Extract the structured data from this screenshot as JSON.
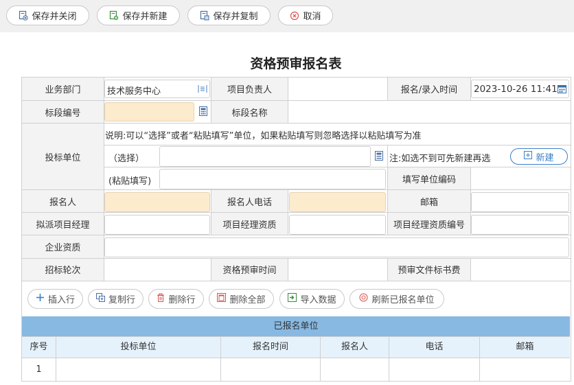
{
  "toolbar": {
    "save_close": "保存并关闭",
    "save_new": "保存并新建",
    "save_copy": "保存并复制",
    "cancel": "取消"
  },
  "form": {
    "title": "资格预审报名表",
    "dept_label": "业务部门",
    "dept_value": "技术服务中心",
    "pm_owner_label": "项目负责人",
    "reg_time_label": "报名/录入时间",
    "reg_time_value": "2023-10-26 11:41",
    "section_no_label": "标段编号",
    "section_name_label": "标段名称",
    "bidder_label": "投标单位",
    "note": "说明:可以“选择”或者“粘贴填写”单位，如果粘贴填写则忽略选择以粘贴填写为准",
    "select_label": "（选择）",
    "select_hint": "注:如选不到可先新建再选",
    "new_button": "新建",
    "paste_label": "(粘贴填写)",
    "unit_code_label": "填写单位编码",
    "applicant_label": "报名人",
    "applicant_phone_label": "报名人电话",
    "email_label": "邮箱",
    "pm_label": "拟派项目经理",
    "pm_qual_label": "项目经理资质",
    "pm_qual_no_label": "项目经理资质编号",
    "company_qual_label": "企业资质",
    "round_label": "招标轮次",
    "prequal_time_label": "资格预审时间",
    "doc_fee_label": "预审文件标书费"
  },
  "row_actions": {
    "insert": "插入行",
    "copy": "复制行",
    "delete": "删除行",
    "delete_all": "删除全部",
    "import": "导入数据",
    "refresh": "刷新已报名单位"
  },
  "registered": {
    "title": "已报名单位",
    "columns": [
      "序号",
      "投标单位",
      "报名时间",
      "报名人",
      "电话",
      "邮箱"
    ],
    "rows": [
      [
        "1",
        "",
        "",
        "",
        "",
        ""
      ]
    ]
  },
  "colors": {
    "required_bg": "#fdebcd",
    "band_bg": "#87b9e3",
    "header_bg": "#e6f2fb",
    "accent": "#3a7fc6"
  }
}
